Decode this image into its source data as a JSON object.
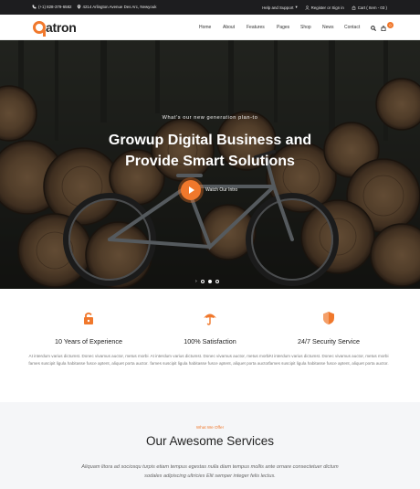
{
  "topbar": {
    "phone": "(+1) 828-379-6582",
    "address": "4214 Arlington Avenue Des Arc, Newyouk",
    "help": "Help and Support",
    "account": "Register or Sign in",
    "cart": "Cart ( Item - 03 )"
  },
  "header": {
    "logo": "atron",
    "nav": [
      "Home",
      "About",
      "Features",
      "Pages",
      "Shop",
      "News",
      "Contact"
    ],
    "cart_count": "0"
  },
  "hero": {
    "kicker": "What's our new generation plan-to",
    "title_line1": "Growup Digital Business and",
    "title_line2": "Provide Smart Solutions",
    "button_label": "Watch Our Intro",
    "slides": 3,
    "active_slide": 1
  },
  "features": [
    {
      "icon": "lock-icon",
      "title": "10 Years of Experience",
      "text": "At interdum varius dictumst. Donec vivamus auctor, metus morbi fames suscipit ligula habitasse fusce aptent, aliquet porta auctor."
    },
    {
      "icon": "umbrella-icon",
      "title": "100% Satisfaction",
      "text": "At interdum varius dictumst. Donec vivamus auctor, metus morbi fames suscipit ligula habitasse fusce aptent, aliquet porta auctor."
    },
    {
      "icon": "shield-icon",
      "title": "24/7 Security Service",
      "text": "At interdum varius dictumst. Donec vivamus auctor, metus morbi fames suscipit ligula habitasse fusce aptent, aliquet porta auctor."
    }
  ],
  "services": {
    "kicker": "What We Offer",
    "title": "Our Awesome Services",
    "text": "Aliquam litora ad sociosqu turpis etiam tempus egestas nulla diam tempus mollis ante ornare consectetuer dictum sodales adipiscing ultricies Elit semper integer felis lectus."
  },
  "colors": {
    "accent": "#f0782c",
    "topbar": "#1d1d1f",
    "services_bg": "#f5f6f8"
  }
}
